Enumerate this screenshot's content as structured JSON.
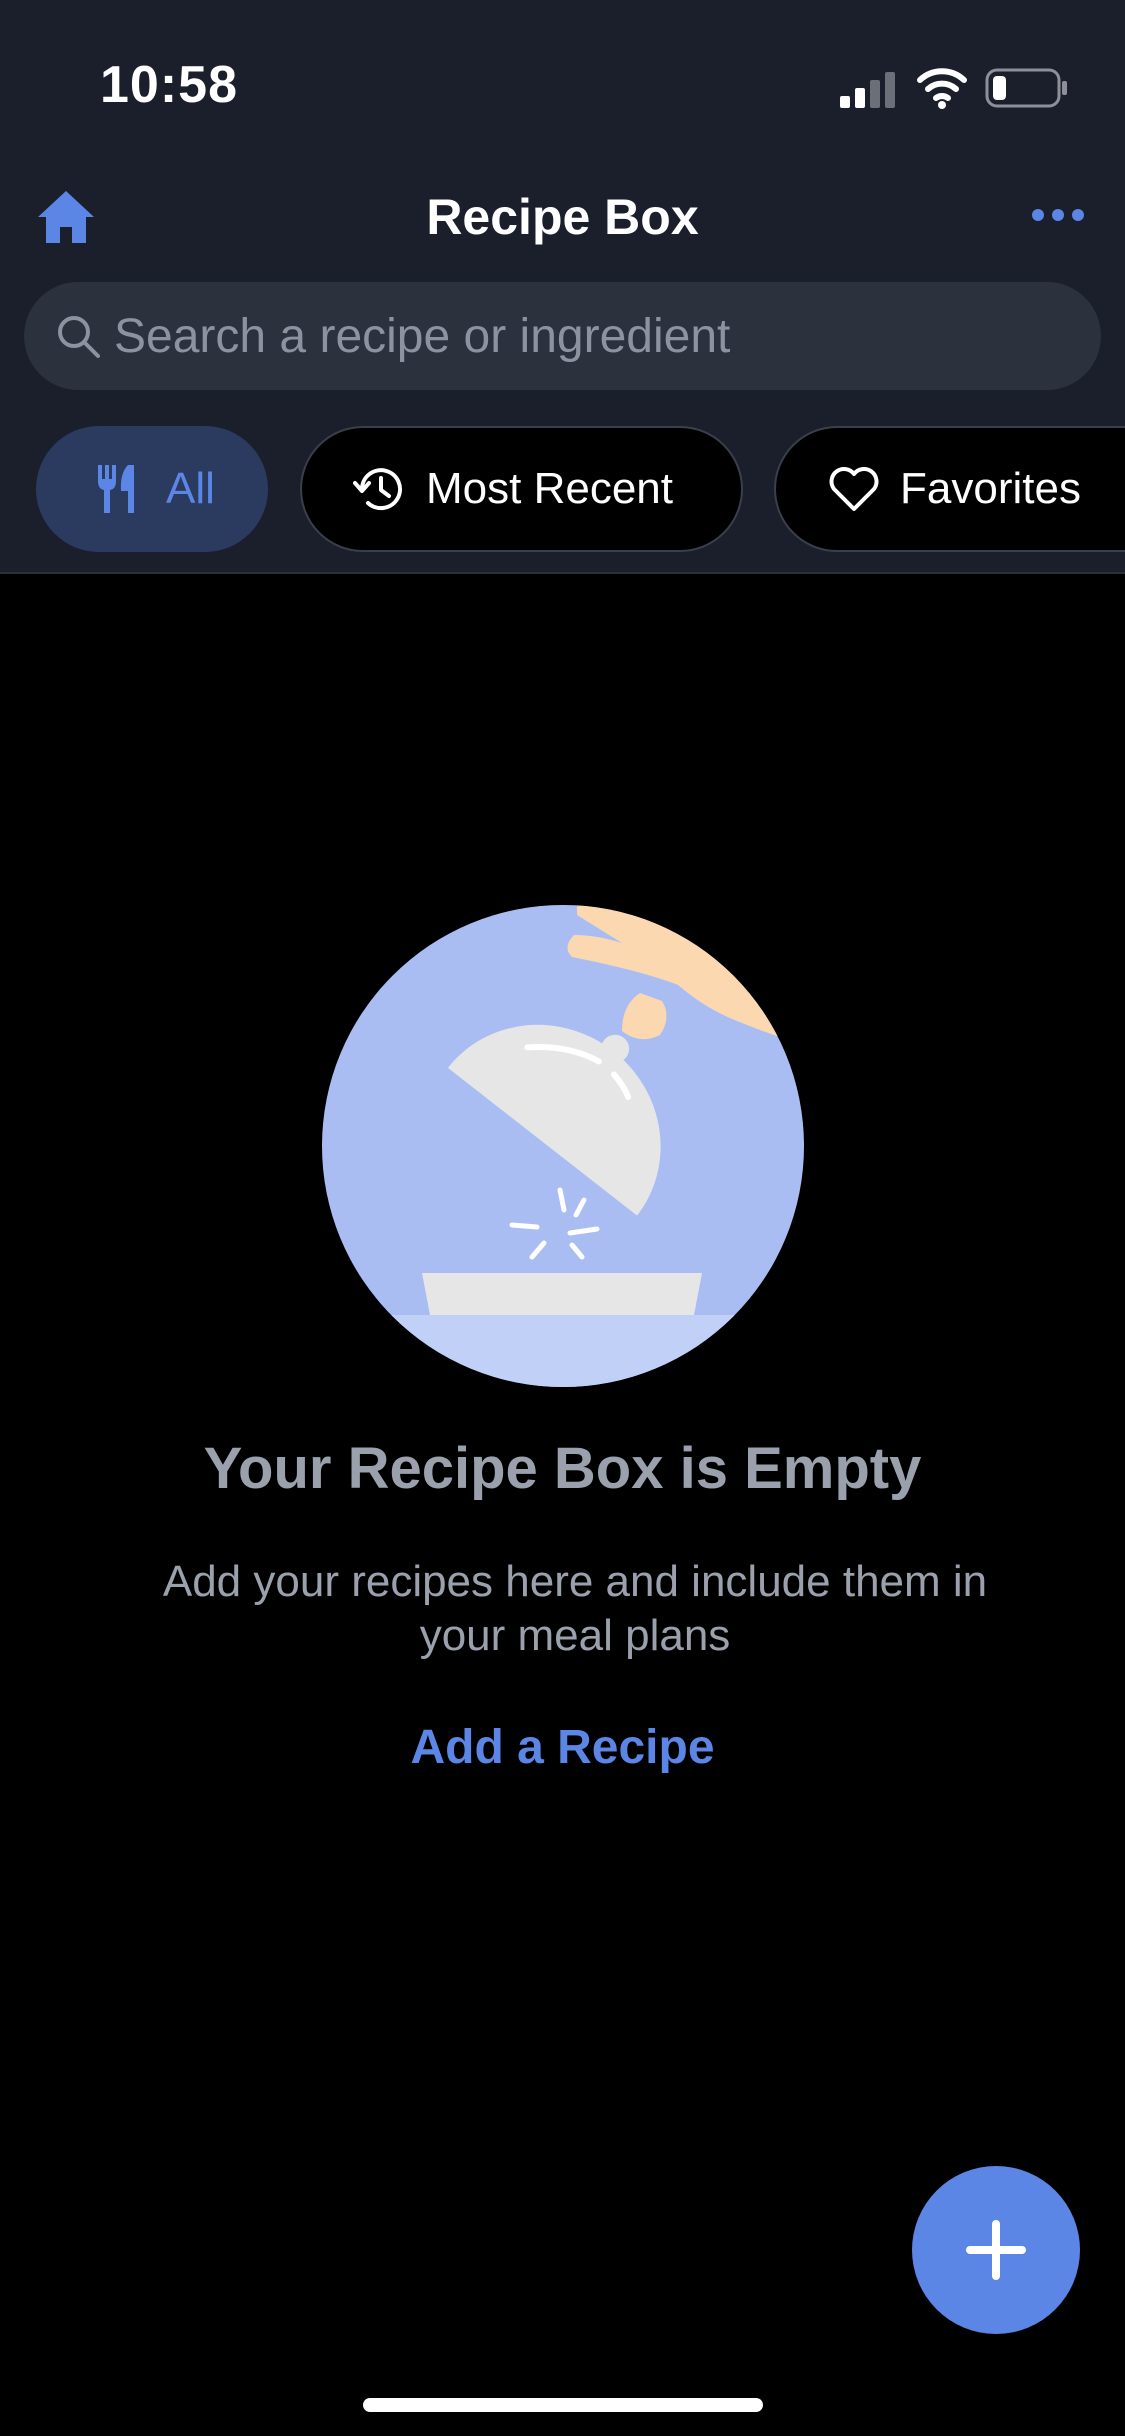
{
  "status_bar": {
    "time": "10:58",
    "signal_icon": "signal-bars-icon",
    "wifi_icon": "wifi-icon",
    "battery_icon": "battery-low-icon",
    "battery_level": 0.2
  },
  "header": {
    "title": "Recipe Box",
    "home_icon": "home-icon",
    "more_icon": "more-dots-icon"
  },
  "search": {
    "placeholder": "Search a recipe or ingredient",
    "value": "",
    "icon": "search-icon"
  },
  "filters": [
    {
      "label": "All",
      "icon": "fork-knife-icon",
      "selected": true
    },
    {
      "label": "Most Recent",
      "icon": "history-clock-icon",
      "selected": false
    },
    {
      "label": "Favorites",
      "icon": "heart-icon",
      "selected": false
    }
  ],
  "empty_state": {
    "illustration": "cloche-reveal-illustration",
    "title": "Your Recipe Box is Empty",
    "description": "Add your recipes here and include them in your meal plans",
    "action_label": "Add a Recipe"
  },
  "fab": {
    "icon": "plus-icon"
  },
  "colors": {
    "accent": "#5b86e5",
    "header_bg": "#1b1f2c",
    "search_bg": "#2c313e",
    "chip_selected_bg": "#2b3b60",
    "muted_text": "#9aa1ad",
    "background": "#000000",
    "illustration_bg": "#a9bdf3",
    "hand": "#fbd8b0"
  }
}
